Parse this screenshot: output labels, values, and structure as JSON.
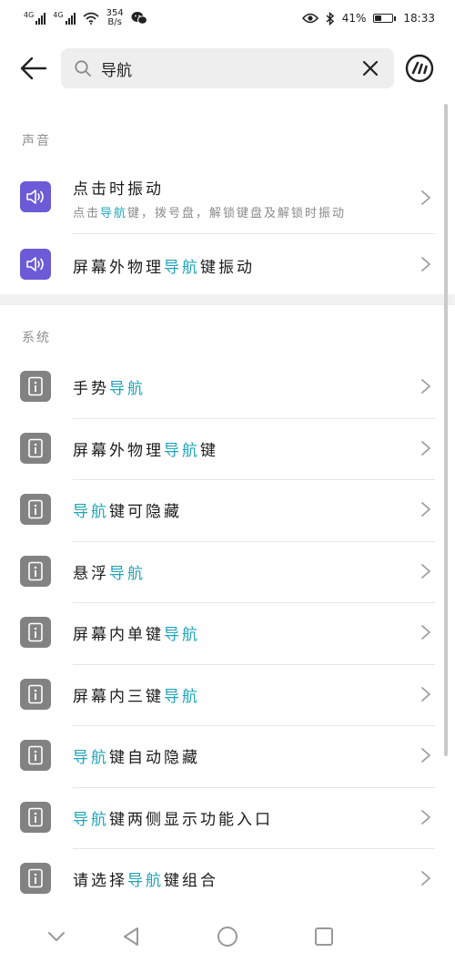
{
  "status_bar": {
    "signal1_label": "4G",
    "signal2_label": "4G",
    "speed_value": "354",
    "speed_unit": "B/s",
    "battery_percent": "41%",
    "battery_level": 0.41,
    "time": "18:33"
  },
  "search": {
    "query": "导航",
    "placeholder": ""
  },
  "colors": {
    "highlight": "#1fa4b7",
    "sound_icon_bg": "#6c5bd6",
    "system_icon_bg": "#828282"
  },
  "sections": {
    "sound": {
      "title": "声音",
      "items": [
        {
          "title": [
            {
              "t": "点击时振动",
              "hl": false
            }
          ],
          "subtitle": [
            {
              "t": "点击",
              "hl": false
            },
            {
              "t": "导航",
              "hl": true
            },
            {
              "t": "键，拨号盘，解锁键盘及解锁时振动",
              "hl": false
            }
          ]
        },
        {
          "title": [
            {
              "t": "屏幕外物理",
              "hl": false
            },
            {
              "t": "导航",
              "hl": true
            },
            {
              "t": "键振动",
              "hl": false
            }
          ]
        }
      ]
    },
    "system": {
      "title": "系统",
      "items": [
        {
          "title": [
            {
              "t": "手势",
              "hl": false
            },
            {
              "t": "导航",
              "hl": true
            }
          ]
        },
        {
          "title": [
            {
              "t": "屏幕外物理",
              "hl": false
            },
            {
              "t": "导航",
              "hl": true
            },
            {
              "t": "键",
              "hl": false
            }
          ]
        },
        {
          "title": [
            {
              "t": "导航",
              "hl": true
            },
            {
              "t": "键可隐藏",
              "hl": false
            }
          ]
        },
        {
          "title": [
            {
              "t": "悬浮",
              "hl": false
            },
            {
              "t": "导航",
              "hl": true
            }
          ]
        },
        {
          "title": [
            {
              "t": "屏幕内单键",
              "hl": false
            },
            {
              "t": "导航",
              "hl": true
            }
          ]
        },
        {
          "title": [
            {
              "t": "屏幕内三键",
              "hl": false
            },
            {
              "t": "导航",
              "hl": true
            }
          ]
        },
        {
          "title": [
            {
              "t": "导航",
              "hl": true
            },
            {
              "t": "键自动隐藏",
              "hl": false
            }
          ]
        },
        {
          "title": [
            {
              "t": "导航",
              "hl": true
            },
            {
              "t": "键两侧显示功能入口",
              "hl": false
            }
          ]
        },
        {
          "title": [
            {
              "t": "请选择",
              "hl": false
            },
            {
              "t": "导航",
              "hl": true
            },
            {
              "t": "键组合",
              "hl": false
            }
          ]
        }
      ]
    }
  },
  "icons": {
    "back": "arrow-left-icon",
    "search": "magnifier-icon",
    "clear": "close-icon",
    "assistant": "assistant-icon",
    "sound_item": "speaker-icon",
    "system_item": "info-icon",
    "row_chevron": "chevron-right-icon",
    "nav_hide": "chevron-down-icon",
    "nav_back": "triangle-back-icon",
    "nav_home": "circle-home-icon",
    "nav_recent": "square-recent-icon"
  }
}
